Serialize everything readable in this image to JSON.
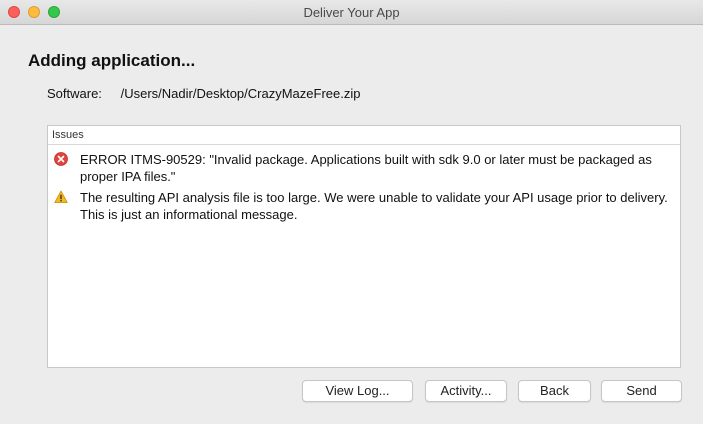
{
  "window": {
    "title": "Deliver Your App"
  },
  "main": {
    "heading": "Adding application...",
    "software_label": "Software:",
    "software_value": "/Users/Nadir/Desktop/CrazyMazeFree.zip"
  },
  "issues": {
    "header": "Issues",
    "items": [
      {
        "severity": "error",
        "icon": "error-icon",
        "text": "ERROR ITMS-90529: \"Invalid package. Applications built with sdk 9.0 or later must be packaged as proper IPA files.\""
      },
      {
        "severity": "warning",
        "icon": "warning-icon",
        "text": "The resulting API analysis file is too large.  We were unable to validate your API usage prior to delivery.  This is just an informational message."
      }
    ]
  },
  "buttons": {
    "view_log": "View Log...",
    "activity": "Activity...",
    "back": "Back",
    "send": "Send"
  },
  "colors": {
    "error": "#e0443e",
    "warning": "#f5b920",
    "close": "#fc605c",
    "minimize": "#fdbc40",
    "maximize": "#34c84a"
  }
}
